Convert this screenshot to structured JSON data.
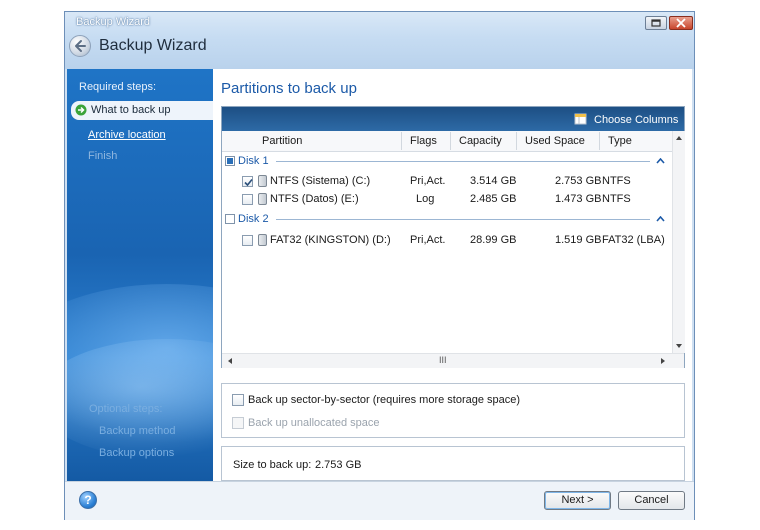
{
  "window": {
    "small_title": "Backup Wizard",
    "title": "Backup Wizard"
  },
  "sidebar": {
    "required_label": "Required steps:",
    "steps": [
      {
        "label": "What to back up",
        "state": "current"
      },
      {
        "label": "Archive location",
        "state": "link"
      },
      {
        "label": "Finish",
        "state": "disabled"
      }
    ],
    "optional_label": "Optional steps:",
    "optional_steps": [
      {
        "label": "Backup method"
      },
      {
        "label": "Backup options"
      }
    ]
  },
  "main": {
    "heading": "Partitions to back up",
    "choose_columns": "Choose Columns",
    "columns": [
      "Partition",
      "Flags",
      "Capacity",
      "Used Space",
      "Type"
    ],
    "scroll_grip": "III",
    "disks": [
      {
        "name": "Disk 1",
        "check_state": "partial",
        "partitions": [
          {
            "checked": true,
            "partition": "NTFS (Sistema) (C:)",
            "flags": "Pri,Act.",
            "capacity": "3.514 GB",
            "used": "2.753 GB",
            "type": "NTFS"
          },
          {
            "checked": false,
            "partition": "NTFS (Datos) (E:)",
            "flags": "Log",
            "capacity": "2.485 GB",
            "used": "1.473 GB",
            "type": "NTFS"
          }
        ]
      },
      {
        "name": "Disk 2",
        "check_state": "unchecked",
        "partitions": [
          {
            "checked": false,
            "partition": "FAT32 (KINGSTON) (D:)",
            "flags": "Pri,Act.",
            "capacity": "28.99 GB",
            "used": "1.519 GB",
            "type": "FAT32 (LBA)"
          }
        ]
      }
    ],
    "options": {
      "sector_by_sector": {
        "label": "Back up sector-by-sector (requires more storage space)",
        "checked": false,
        "enabled": true
      },
      "unallocated": {
        "label": "Back up unallocated space",
        "checked": false,
        "enabled": false
      }
    },
    "size": {
      "label": "Size to back up:",
      "value": "2.753 GB"
    }
  },
  "footer": {
    "help_label": "?",
    "next_label": "Next >",
    "cancel_label": "Cancel"
  },
  "colors": {
    "accent": "#1c5aa8",
    "sidebar": "#1a64b2",
    "toolbar": "#1d4f84"
  }
}
